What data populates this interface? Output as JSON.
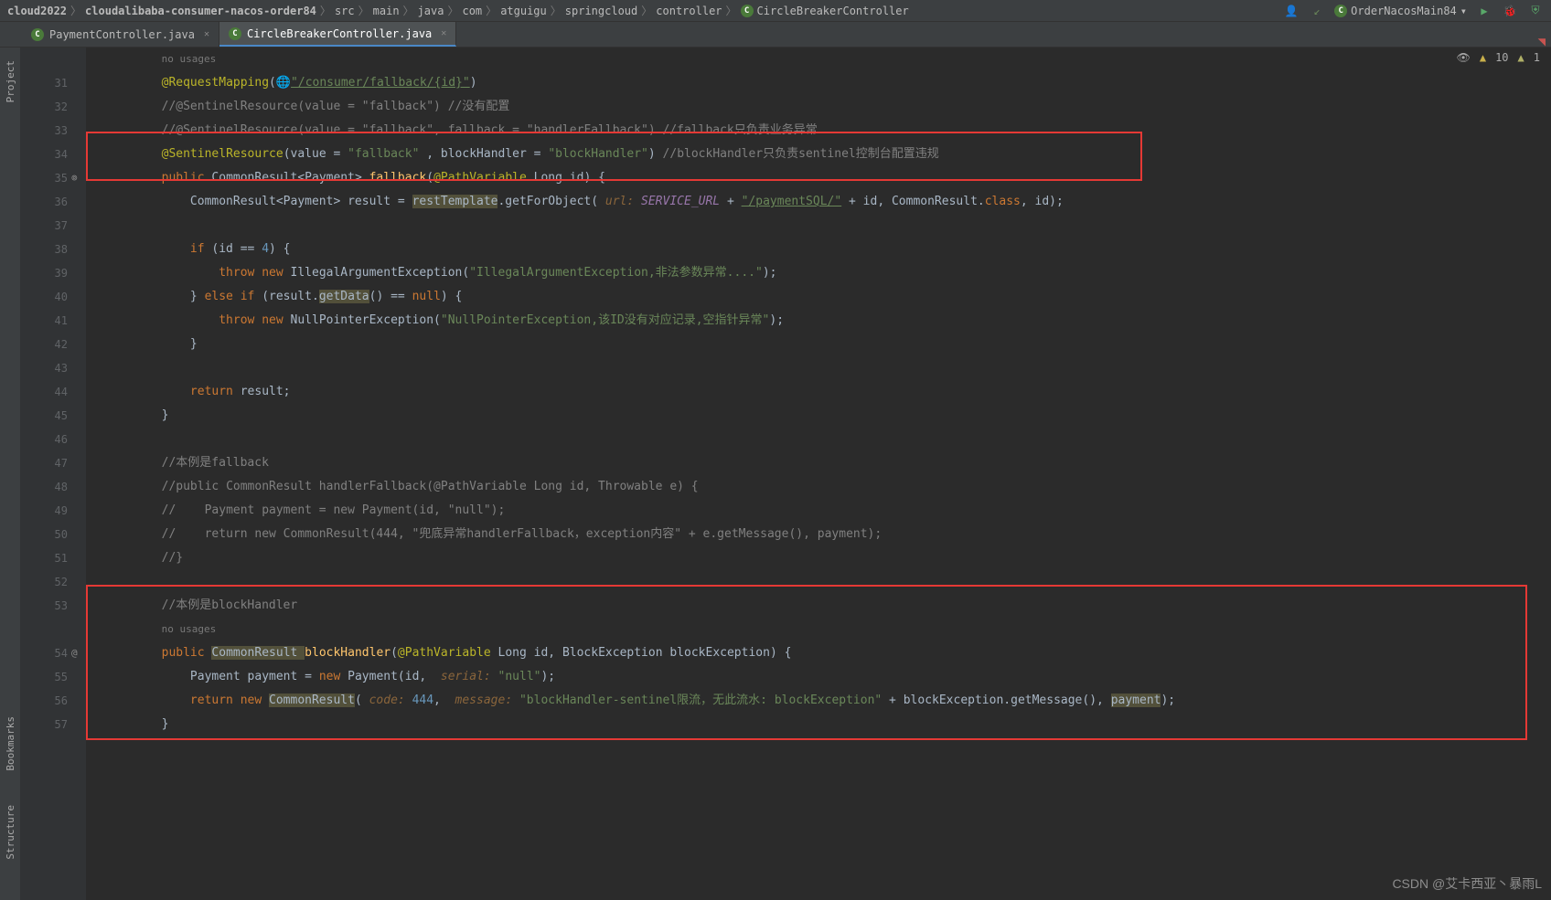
{
  "breadcrumbs": [
    "cloud2022",
    "cloudalibaba-consumer-nacos-order84",
    "src",
    "main",
    "java",
    "com",
    "atguigu",
    "springcloud",
    "controller",
    "CircleBreakerController"
  ],
  "runConfig": "OrderNacosMain84",
  "tabs": [
    {
      "label": "PaymentController.java",
      "active": false
    },
    {
      "label": "CircleBreakerController.java",
      "active": true
    }
  ],
  "sideTools": [
    "Project",
    "Bookmarks",
    "Structure"
  ],
  "inspections": {
    "warnings": "10",
    "errors": "1"
  },
  "gutter": {
    "start": 31,
    "end": 57,
    "noUsagesTop": "no usages",
    "noUsagesMid": "no usages"
  },
  "code": {
    "l31_a": "@RequestMapping",
    "l31_b": "(",
    "l31_c": "\"/consumer/fallback/{id}\"",
    "l31_d": ")",
    "l32": "//@SentinelResource(value = \"fallback\") //没有配置",
    "l33": "//@SentinelResource(value = \"fallback\", fallback = \"handlerFallback\") //fallback只负责业务异常",
    "l34_a": "@SentinelResource",
    "l34_b": "(value = ",
    "l34_c": "\"fallback\"",
    "l34_d": " , blockHandler = ",
    "l34_e": "\"blockHandler\"",
    "l34_f": ") ",
    "l34_g": "//blockHandler只负责sentinel控制台配置违规",
    "l35_a": "public ",
    "l35_b": "CommonResult<Payment> ",
    "l35_c": "fallback",
    "l35_d": "(",
    "l35_e": "@PathVariable ",
    "l35_f": "Long ",
    "l35_g": "id",
    "l35_h": ") {",
    "l36_a": "CommonResult<Payment> ",
    "l36_b": "result ",
    "l36_c": "= ",
    "l36_d": "restTemplate",
    "l36_e": ".getForObject(",
    "l36_f": " url: ",
    "l36_g": "SERVICE_URL",
    "l36_h": " + ",
    "l36_i": "\"/paymentSQL/\"",
    "l36_j": " + id, CommonResult.",
    "l36_k": "class",
    "l36_l": ", id);",
    "l38_a": "if ",
    "l38_b": "(id == ",
    "l38_c": "4",
    "l38_d": ") {",
    "l39_a": "throw new ",
    "l39_b": "IllegalArgumentException(",
    "l39_c": "\"IllegalArgumentException,非法参数异常....\"",
    "l39_d": ");",
    "l40_a": "} ",
    "l40_b": "else if ",
    "l40_c": "(result.",
    "l40_d": "getData",
    "l40_e": "() == ",
    "l40_f": "null",
    "l40_g": ") {",
    "l41_a": "throw new ",
    "l41_b": "NullPointerException(",
    "l41_c": "\"NullPointerException,该ID没有对应记录,空指针异常\"",
    "l41_d": ");",
    "l42": "}",
    "l44_a": "return ",
    "l44_b": "result;",
    "l45": "}",
    "l47": "//本例是fallback",
    "l48": "//public CommonResult handlerFallback(@PathVariable Long id, Throwable e) {",
    "l49": "//    Payment payment = new Payment(id, \"null\");",
    "l50": "//    return new CommonResult(444, \"兜底异常handlerFallback，exception内容\" + e.getMessage(), payment);",
    "l51": "//}",
    "l53": "//本例是blockHandler",
    "l54_a": "public ",
    "l54_b": "CommonResult ",
    "l54_c": "blockHandler",
    "l54_d": "(",
    "l54_e": "@PathVariable ",
    "l54_f": "Long ",
    "l54_g": "id",
    "l54_h": ", BlockException ",
    "l54_i": "blockException",
    "l54_j": ") {",
    "l55_a": "Payment ",
    "l55_b": "payment ",
    "l55_c": "= ",
    "l55_d": "new ",
    "l55_e": "Payment(id, ",
    "l55_f": " serial: ",
    "l55_g": "\"null\"",
    "l55_h": ");",
    "l56_a": "return new ",
    "l56_b": "CommonResult",
    "l56_c": "( ",
    "l56_d": "code: ",
    "l56_e": "444",
    "l56_f": ",  ",
    "l56_g": "message: ",
    "l56_h": "\"blockHandler-sentinel限流，无此流水: blockException\"",
    "l56_i": " + blockException.getMessage(), ",
    "l56_j": "payment",
    "l56_k": ");",
    "l57": "}"
  },
  "watermark": "CSDN @艾卡西亚丶暴雨L"
}
